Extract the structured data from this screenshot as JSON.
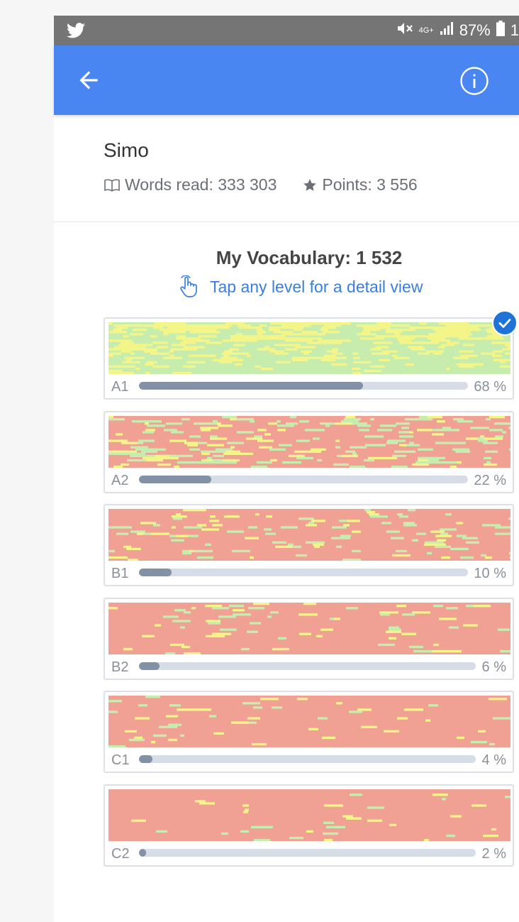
{
  "status_bar": {
    "app_icon": "twitter-icon",
    "network": "4G+",
    "battery": "87%",
    "clock_partial": "1"
  },
  "app_bar": {
    "back_icon": "arrow-left-icon",
    "info_icon": "info-circle-icon"
  },
  "profile": {
    "name": "Simo",
    "words_read": "Words read: 333 303",
    "points": "Points: 3 556"
  },
  "vocabulary": {
    "title": "My Vocabulary: 1 532",
    "hint": "Tap any level for a detail view"
  },
  "levels": [
    {
      "label": "A1",
      "percent_text": "68 %",
      "progress": 0.68,
      "selected": true,
      "known": 0.44,
      "learning": 0.56
    },
    {
      "label": "A2",
      "percent_text": "22 %",
      "progress": 0.22,
      "selected": false,
      "known": 0.17,
      "learning": 0.08
    },
    {
      "label": "B1",
      "percent_text": "10 %",
      "progress": 0.1,
      "selected": false,
      "known": 0.09,
      "learning": 0.06
    },
    {
      "label": "B2",
      "percent_text": "6 %",
      "progress": 0.06,
      "selected": false,
      "known": 0.05,
      "learning": 0.04
    },
    {
      "label": "C1",
      "percent_text": "4 %",
      "progress": 0.04,
      "selected": false,
      "known": 0.03,
      "learning": 0.035
    },
    {
      "label": "C2",
      "percent_text": "2 %",
      "progress": 0.02,
      "selected": false,
      "known": 0.015,
      "learning": 0.02
    }
  ],
  "colors": {
    "app_bar": "#4a86f2",
    "accent_text": "#3a7ee0",
    "heat_unknown": "#f0a194",
    "heat_known": "#c6ecae",
    "heat_learning": "#f4f589",
    "progress_fill": "#8391a6",
    "progress_track": "#d7dde7"
  }
}
